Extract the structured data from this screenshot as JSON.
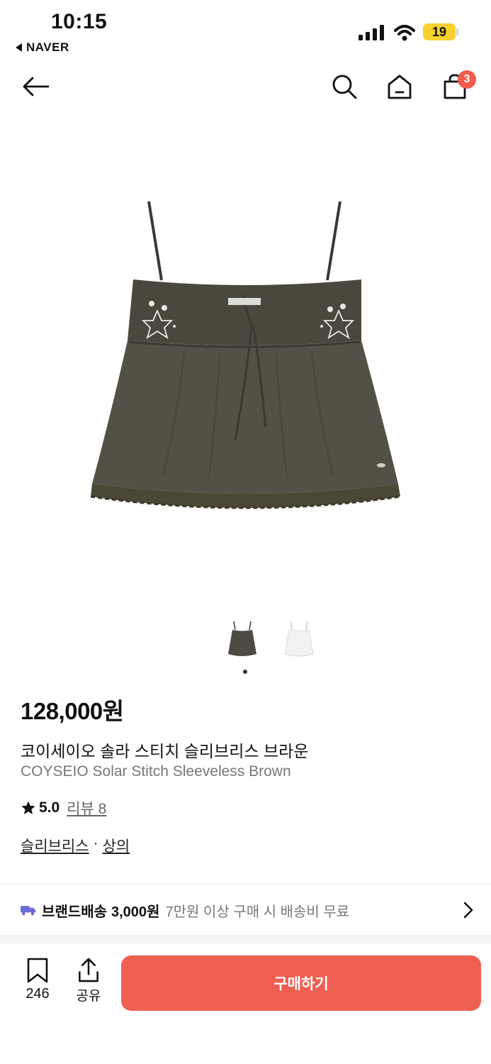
{
  "status_bar": {
    "time": "10:15",
    "back_app": "NAVER",
    "battery": "19",
    "colors": {
      "battery": "#f6d02f"
    }
  },
  "nav": {
    "icons": [
      "back-arrow-icon",
      "search-icon",
      "home-icon",
      "shopping-bag-icon"
    ],
    "cart_badge": "3"
  },
  "product": {
    "thumbnails": [
      "brown camisole thumbnail",
      "white camisole thumbnail"
    ],
    "selected_thumbnail": 1,
    "price": "128,000원",
    "name_ko": "코이세이오 솔라 스티치 슬리브리스 브라운",
    "name_en": "COYSEIO Solar Stitch Sleeveless Brown",
    "rating": "5.0",
    "review_label": "리뷰 8",
    "categories": [
      "슬리브리스",
      "상의"
    ],
    "category_sep": "·"
  },
  "shipping": {
    "label": "브랜드배송",
    "fee": "3,000원",
    "note": "7만원 이상 구매 시 배송비 무료"
  },
  "bottom_bar": {
    "bookmark_count": "246",
    "share_label": "공유",
    "buy_label": "구매하기",
    "colors": {
      "buy": "#ef5f52",
      "badge": "#ef5b4c"
    }
  }
}
